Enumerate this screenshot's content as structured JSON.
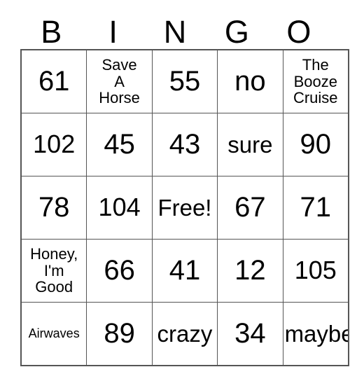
{
  "card": {
    "headers": [
      "B",
      "I",
      "N",
      "G",
      "O"
    ],
    "rows": [
      [
        {
          "text": "61",
          "size": "xl"
        },
        {
          "text": "Save\nA\nHorse",
          "size": "sm"
        },
        {
          "text": "55",
          "size": "xl"
        },
        {
          "text": "no",
          "size": "xl"
        },
        {
          "text": "The\nBooze\nCruise",
          "size": "sm"
        }
      ],
      [
        {
          "text": "102",
          "size": "lg"
        },
        {
          "text": "45",
          "size": "xl"
        },
        {
          "text": "43",
          "size": "xl"
        },
        {
          "text": "sure",
          "size": "md"
        },
        {
          "text": "90",
          "size": "xl"
        }
      ],
      [
        {
          "text": "78",
          "size": "xl"
        },
        {
          "text": "104",
          "size": "lg"
        },
        {
          "text": "Free!",
          "size": "md"
        },
        {
          "text": "67",
          "size": "xl"
        },
        {
          "text": "71",
          "size": "xl"
        }
      ],
      [
        {
          "text": "Honey,\nI'm\nGood",
          "size": "sm"
        },
        {
          "text": "66",
          "size": "xl"
        },
        {
          "text": "41",
          "size": "xl"
        },
        {
          "text": "12",
          "size": "xl"
        },
        {
          "text": "105",
          "size": "lg"
        }
      ],
      [
        {
          "text": "Airwaves",
          "size": "xs"
        },
        {
          "text": "89",
          "size": "xl"
        },
        {
          "text": "crazy",
          "size": "md"
        },
        {
          "text": "34",
          "size": "xl"
        },
        {
          "text": "maybe",
          "size": "md"
        }
      ]
    ],
    "free_space": {
      "row": 2,
      "col": 2,
      "label": "Free!"
    },
    "colors": {
      "background": "#ffffff",
      "text": "#000000",
      "border": "#555555"
    }
  }
}
